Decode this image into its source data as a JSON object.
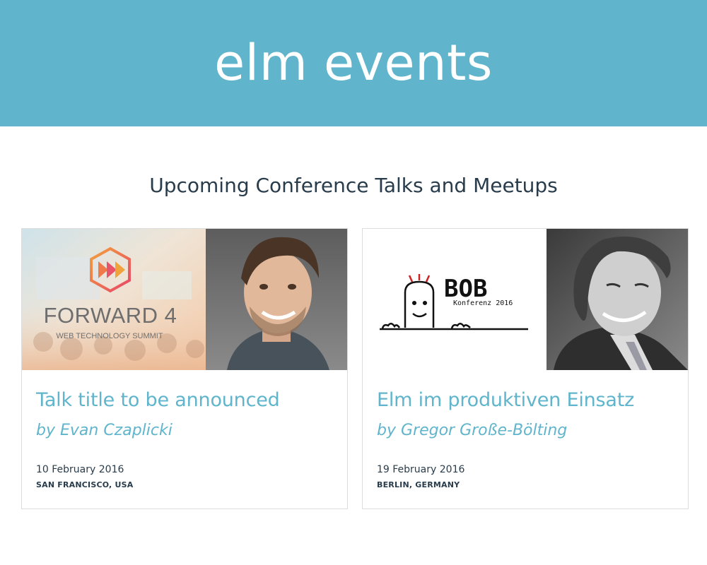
{
  "header": {
    "site_title": "elm events"
  },
  "main": {
    "section_title": "Upcoming Conference Talks and Meetups",
    "events": [
      {
        "title": "Talk title to be announced",
        "speaker": "by Evan Czaplicki",
        "date": "10 February 2016",
        "location": "SAN FRANCISCO, USA",
        "conference_logo": {
          "name": "FORWARD 4",
          "tagline": "WEB TECHNOLOGY SUMMIT"
        }
      },
      {
        "title": "Elm im produktiven Einsatz",
        "speaker": "by Gregor Große-Bölting",
        "date": "19 February 2016",
        "location": "BERLIN, GERMANY",
        "conference_logo": {
          "name": "BOB",
          "tagline": "Konferenz 2016"
        }
      }
    ]
  },
  "colors": {
    "brand": "#60b5cc",
    "text": "#293c4b",
    "card_border": "#dcdcdc"
  }
}
